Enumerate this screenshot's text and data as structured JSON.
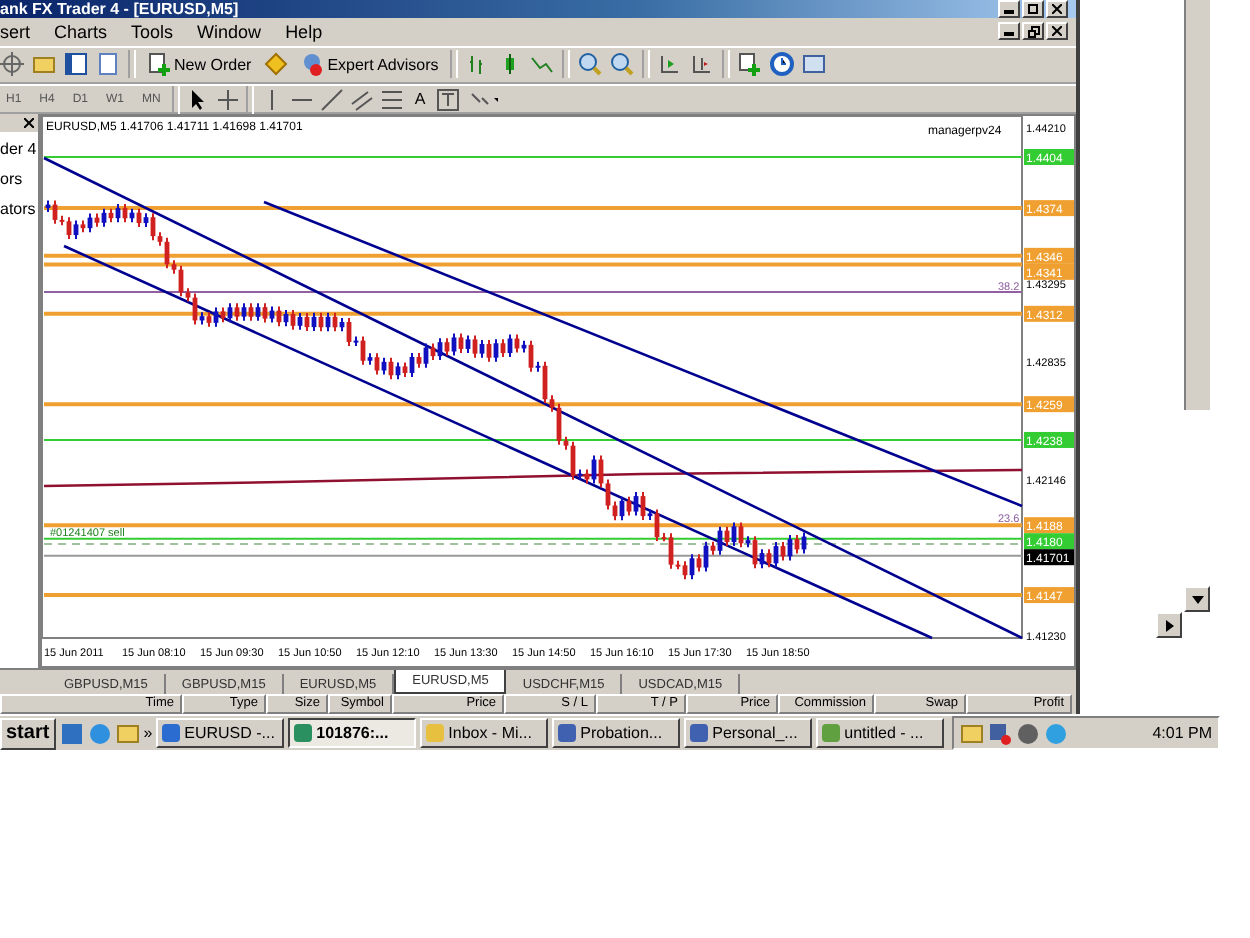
{
  "window": {
    "title": "ank FX Trader 4 - [EURUSD,M5]"
  },
  "menu": [
    "sert",
    "Charts",
    "Tools",
    "Window",
    "Help"
  ],
  "toolbar": {
    "buttons": [
      "New Order",
      "Expert Advisors"
    ]
  },
  "timeframes": [
    "H1",
    "H4",
    "D1",
    "W1",
    "MN"
  ],
  "text_tool": "A",
  "navigator": {
    "lines": [
      "der 4",
      "ors",
      "ators"
    ]
  },
  "chart": {
    "header": "EURUSD,M5  1.41706 1.41711 1.41698 1.41701",
    "indicator": "managerpv24",
    "price_axis": [
      "1.44210",
      "1.43295",
      "1.42835",
      "1.42146",
      "1.41230"
    ],
    "price_tags": [
      {
        "text": "1.4404",
        "color": "#33cc33"
      },
      {
        "text": "1.4374",
        "color": "#f0a030"
      },
      {
        "text": "1.4346",
        "color": "#f0a030"
      },
      {
        "text": "1.4341",
        "color": "#f0a030"
      },
      {
        "text": "1.4312",
        "color": "#f0a030"
      },
      {
        "text": "1.4259",
        "color": "#f0a030"
      },
      {
        "text": "1.4238",
        "color": "#33cc33"
      },
      {
        "text": "1.4188",
        "color": "#f0a030"
      },
      {
        "text": "1.4180",
        "color": "#33cc33"
      },
      {
        "text": "1.41701",
        "color": "#000000"
      },
      {
        "text": "1.4147",
        "color": "#f0a030"
      }
    ],
    "fib_labels": [
      "38.2",
      "23.6"
    ],
    "order_label": "#01241407 sell",
    "time_axis": [
      "15 Jun 2011",
      "15 Jun 08:10",
      "15 Jun 09:30",
      "15 Jun 10:50",
      "15 Jun 12:10",
      "15 Jun 13:30",
      "15 Jun 14:50",
      "15 Jun 16:10",
      "15 Jun 17:30",
      "15 Jun 18:50"
    ]
  },
  "chart_tabs": [
    {
      "label": "GBPUSD,M15",
      "selected": false
    },
    {
      "label": "GBPUSD,M15",
      "selected": false
    },
    {
      "label": "EURUSD,M5",
      "selected": false
    },
    {
      "label": "EURUSD,M5",
      "selected": true
    },
    {
      "label": "USDCHF,M15",
      "selected": false
    },
    {
      "label": "USDCAD,M15",
      "selected": false
    }
  ],
  "terminal": {
    "columns": [
      "Time",
      "Type",
      "Size",
      "Symbol",
      "Price",
      "S / L",
      "T / P",
      "Price",
      "Commission",
      "Swap",
      "Profit"
    ]
  },
  "taskbar": {
    "start": "start",
    "more": "»",
    "tasks": [
      {
        "label": "EURUSD -...",
        "selected": false
      },
      {
        "label": "101876:...",
        "selected": true
      },
      {
        "label": "Inbox - Mi...",
        "selected": false
      },
      {
        "label": "Probation...",
        "selected": false
      },
      {
        "label": "Personal_...",
        "selected": false
      },
      {
        "label": "untitled - ...",
        "selected": false
      }
    ],
    "clock": "4:01 PM"
  }
}
